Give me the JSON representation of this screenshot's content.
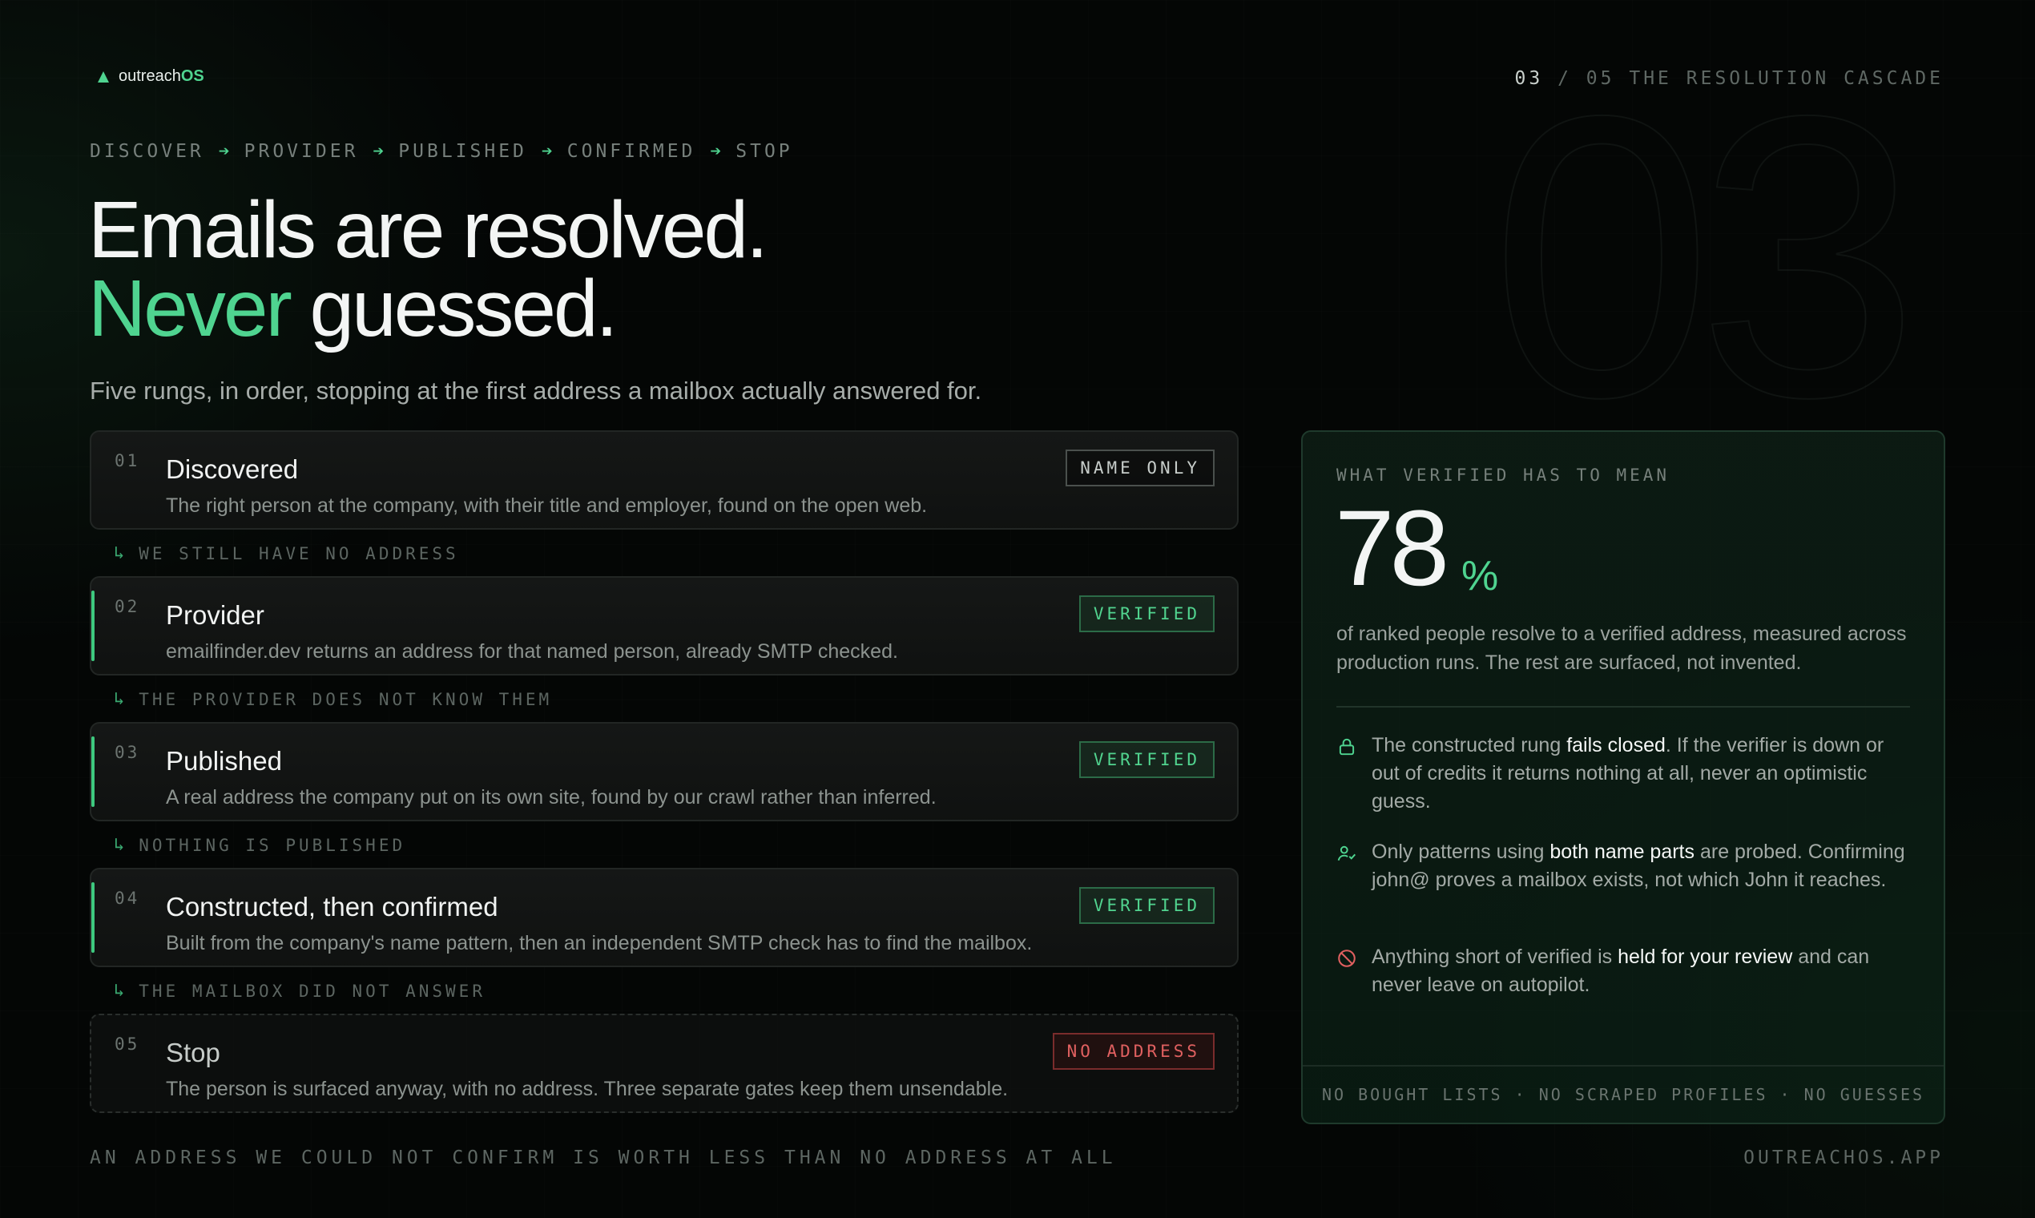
{
  "brand": {
    "name_prefix": "outreach",
    "name_suffix": "OS"
  },
  "page": {
    "current": "03",
    "separator": "/",
    "total": "05",
    "section": "THE RESOLUTION CASCADE",
    "watermark": "03"
  },
  "pipeline": {
    "steps": [
      "DISCOVER",
      "PROVIDER",
      "PUBLISHED",
      "CONFIRMED",
      "STOP"
    ],
    "arrow": "➔"
  },
  "headline": {
    "line1": "Emails are resolved.",
    "accent": "Never",
    "rest": " guessed."
  },
  "subhead": "Five rungs, in order, stopping at the first address a mailbox actually answered for.",
  "rungs": [
    {
      "num": "01",
      "title": "Discovered",
      "desc": "The right person at the company, with their title and employer, found on the open web.",
      "tag": "NAME ONLY",
      "fall": "WE STILL HAVE NO ADDRESS"
    },
    {
      "num": "02",
      "title": "Provider",
      "desc": "emailfinder.dev returns an address for that named person, already SMTP checked.",
      "tag": "VERIFIED",
      "fall": "THE PROVIDER DOES NOT KNOW THEM"
    },
    {
      "num": "03",
      "title": "Published",
      "desc": "A real address the company put on its own site, found by our crawl rather than inferred.",
      "tag": "VERIFIED",
      "fall": "NOTHING IS PUBLISHED"
    },
    {
      "num": "04",
      "title": "Constructed, then confirmed",
      "desc": "Built from the company's name pattern, then an independent SMTP check has to find the mailbox.",
      "tag": "VERIFIED",
      "fall": "THE MAILBOX DID NOT ANSWER"
    },
    {
      "num": "05",
      "title": "Stop",
      "desc": "The person is surfaced anyway, with no address. Three separate gates keep them unsendable.",
      "tag": "NO ADDRESS"
    }
  ],
  "panel": {
    "label": "WHAT VERIFIED HAS TO MEAN",
    "stat": "78",
    "stat_unit": "%",
    "stat_desc": "of ranked people resolve to a verified address, measured across production runs. The rest are surfaced, not invented.",
    "points": [
      {
        "icon": "lock-icon",
        "pre": "The constructed rung ",
        "bold": "fails closed",
        "post": ". If the verifier is down or out of credits it returns nothing at all, never an optimistic guess."
      },
      {
        "icon": "user-check-icon",
        "pre": "Only patterns using ",
        "bold": "both name parts",
        "post": " are probed. Confirming john@ proves a mailbox exists, not which John it reaches."
      },
      {
        "icon": "ban-icon",
        "pre": "Anything short of verified is ",
        "bold": "held for your review",
        "post": " and can never leave on autopilot."
      }
    ],
    "footer": "NO BOUGHT LISTS · NO SCRAPED PROFILES · NO GUESSES"
  },
  "footer": {
    "left": "AN ADDRESS WE COULD NOT CONFIRM IS WORTH LESS THAN NO ADDRESS AT ALL",
    "right": "OUTREACHOS.APP"
  },
  "colors": {
    "accent": "#4fd490",
    "danger": "#e06060",
    "background": "#040605"
  }
}
